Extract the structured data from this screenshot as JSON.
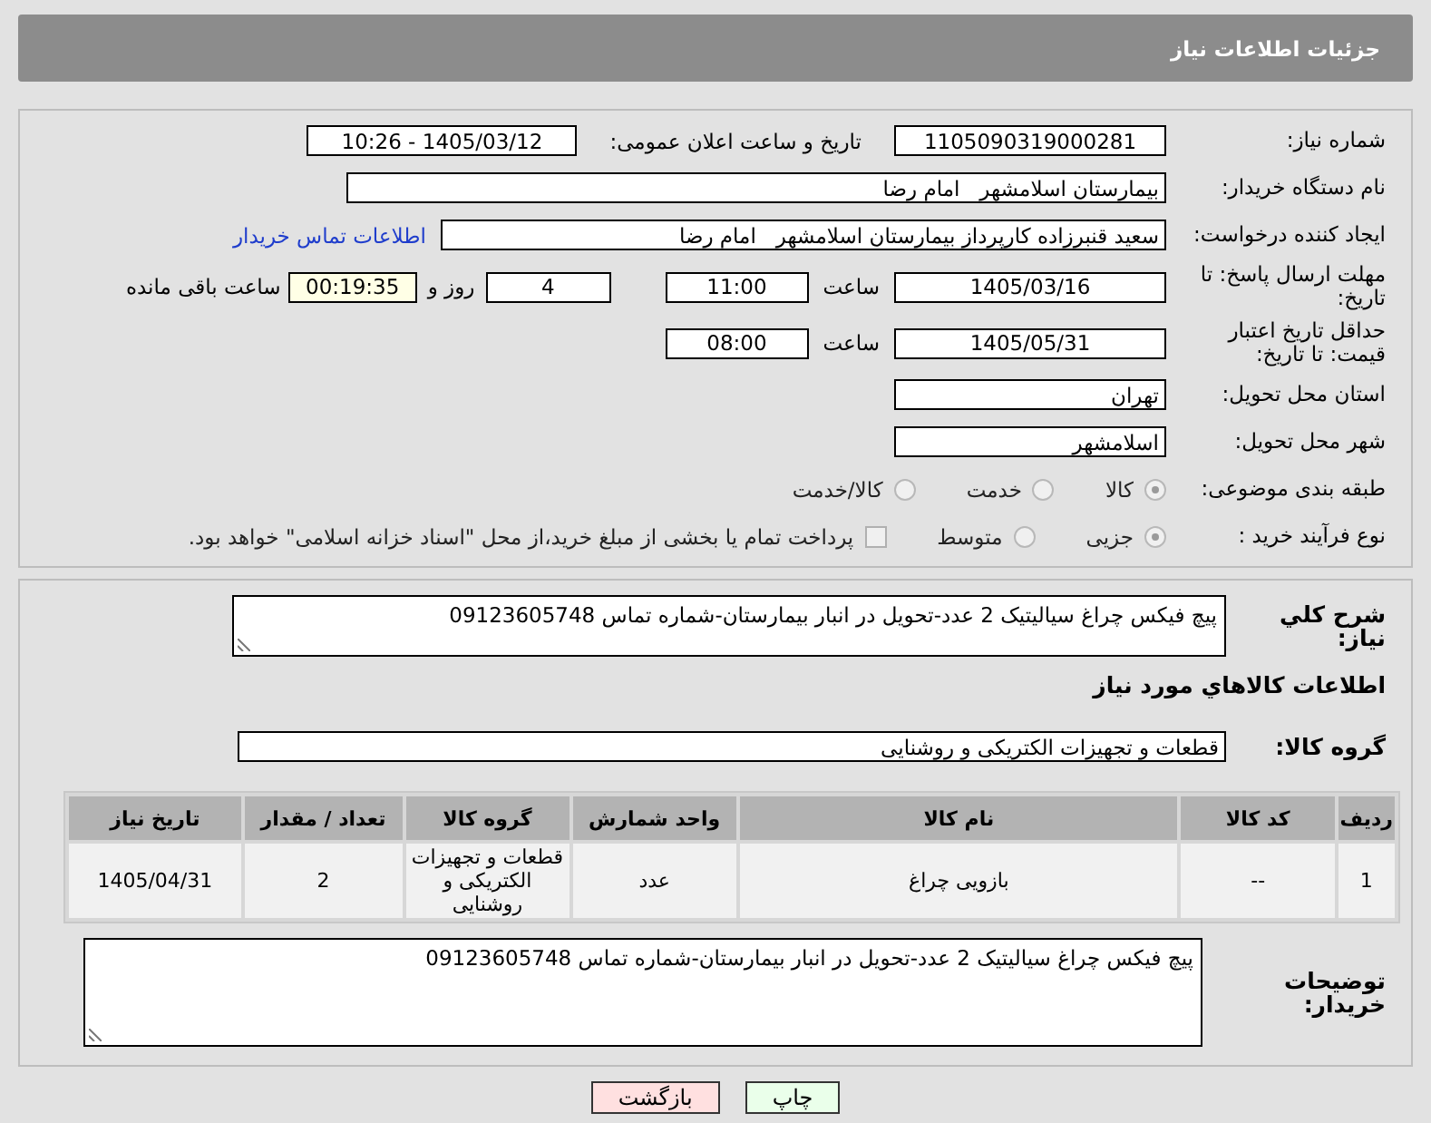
{
  "header": {
    "title": "جزئیات اطلاعات نیاز"
  },
  "need_number": {
    "label": "شماره نیاز:",
    "value": "1105090319000281"
  },
  "announce": {
    "label": "تاریخ و ساعت اعلان عمومی:",
    "value": "1405/03/12 - 10:26"
  },
  "buyer_org": {
    "label": "نام دستگاه خریدار:",
    "value": "بیمارستان اسلامشهر   امام رضا"
  },
  "creator": {
    "label": "ایجاد کننده درخواست:",
    "value": "سعید قنبرزاده کارپرداز بیمارستان اسلامشهر   امام رضا",
    "link": "اطلاعات تماس خریدار"
  },
  "deadline": {
    "label": "مهلت ارسال پاسخ: تا تاریخ:",
    "date": "1405/03/16",
    "time_label": "ساعت",
    "time": "11:00",
    "days": "4",
    "days_label": "روز و",
    "remaining": "00:19:35",
    "remaining_label": "ساعت باقی مانده"
  },
  "validity": {
    "label": "حداقل تاریخ اعتبار قیمت: تا تاریخ:",
    "date": "1405/05/31",
    "time_label": "ساعت",
    "time": "08:00"
  },
  "province": {
    "label": "استان محل تحویل:",
    "value": "تهران"
  },
  "city": {
    "label": "شهر محل تحویل:",
    "value": "اسلامشهر"
  },
  "category": {
    "label": "طبقه بندی موضوعی:",
    "options": [
      {
        "label": "کالا",
        "selected": true
      },
      {
        "label": "خدمت",
        "selected": false
      },
      {
        "label": "کالا/خدمت",
        "selected": false
      }
    ]
  },
  "process": {
    "label": "نوع فرآیند خرید :",
    "options": [
      {
        "label": "جزیی",
        "selected": true
      },
      {
        "label": "متوسط",
        "selected": false
      }
    ],
    "treasury": {
      "label": "پرداخت تمام یا بخشی از مبلغ خرید،از محل \"اسناد خزانه اسلامی\" خواهد بود.",
      "checked": false
    }
  },
  "description": {
    "label": "شرح کلي نياز:",
    "value": "پیچ فیکس چراغ سیالیتیک 2 عدد-تحویل در انبار بیمارستان-شماره تماس 09123605748"
  },
  "goods_title": "اطلاعات كالاهاي مورد نياز",
  "goods_group": {
    "label": "گروه کالا:",
    "value": "قطعات و تجهیزات الکتریکی و روشنایی"
  },
  "table": {
    "columns": [
      "ردیف",
      "کد کالا",
      "نام کالا",
      "واحد شمارش",
      "گروه کالا",
      "تعداد / مقدار",
      "تاریخ نیاز"
    ],
    "rows": [
      [
        "1",
        "--",
        "بازویی چراغ",
        "عدد",
        "قطعات و تجهیزات الکتریکی و روشنایی",
        "2",
        "1405/04/31"
      ]
    ]
  },
  "buyer_notes": {
    "label": "توضیحات خریدار:",
    "value": "پیچ فیکس چراغ سیالیتیک 2 عدد-تحویل در انبار بیمارستان-شماره تماس 09123605748"
  },
  "buttons": [
    {
      "label": "چاپ",
      "kind": "print"
    },
    {
      "label": "بازگشت",
      "kind": "back"
    }
  ]
}
